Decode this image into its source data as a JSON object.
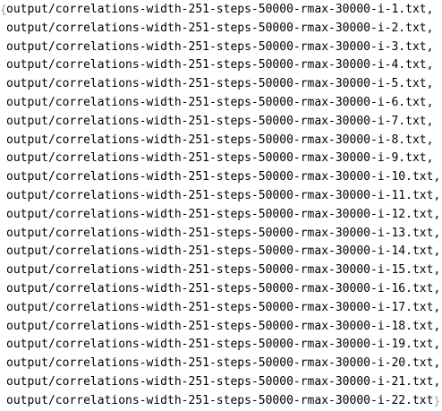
{
  "output": {
    "open_brace": "{",
    "close_brace": "}",
    "separator": ",",
    "items": [
      "output/correlations-width-251-steps-50000-rmax-30000-i-1.txt",
      "output/correlations-width-251-steps-50000-rmax-30000-i-2.txt",
      "output/correlations-width-251-steps-50000-rmax-30000-i-3.txt",
      "output/correlations-width-251-steps-50000-rmax-30000-i-4.txt",
      "output/correlations-width-251-steps-50000-rmax-30000-i-5.txt",
      "output/correlations-width-251-steps-50000-rmax-30000-i-6.txt",
      "output/correlations-width-251-steps-50000-rmax-30000-i-7.txt",
      "output/correlations-width-251-steps-50000-rmax-30000-i-8.txt",
      "output/correlations-width-251-steps-50000-rmax-30000-i-9.txt",
      "output/correlations-width-251-steps-50000-rmax-30000-i-10.txt",
      "output/correlations-width-251-steps-50000-rmax-30000-i-11.txt",
      "output/correlations-width-251-steps-50000-rmax-30000-i-12.txt",
      "output/correlations-width-251-steps-50000-rmax-30000-i-13.txt",
      "output/correlations-width-251-steps-50000-rmax-30000-i-14.txt",
      "output/correlations-width-251-steps-50000-rmax-30000-i-15.txt",
      "output/correlations-width-251-steps-50000-rmax-30000-i-16.txt",
      "output/correlations-width-251-steps-50000-rmax-30000-i-17.txt",
      "output/correlations-width-251-steps-50000-rmax-30000-i-18.txt",
      "output/correlations-width-251-steps-50000-rmax-30000-i-19.txt",
      "output/correlations-width-251-steps-50000-rmax-30000-i-20.txt",
      "output/correlations-width-251-steps-50000-rmax-30000-i-21.txt",
      "output/correlations-width-251-steps-50000-rmax-30000-i-22.txt"
    ]
  }
}
